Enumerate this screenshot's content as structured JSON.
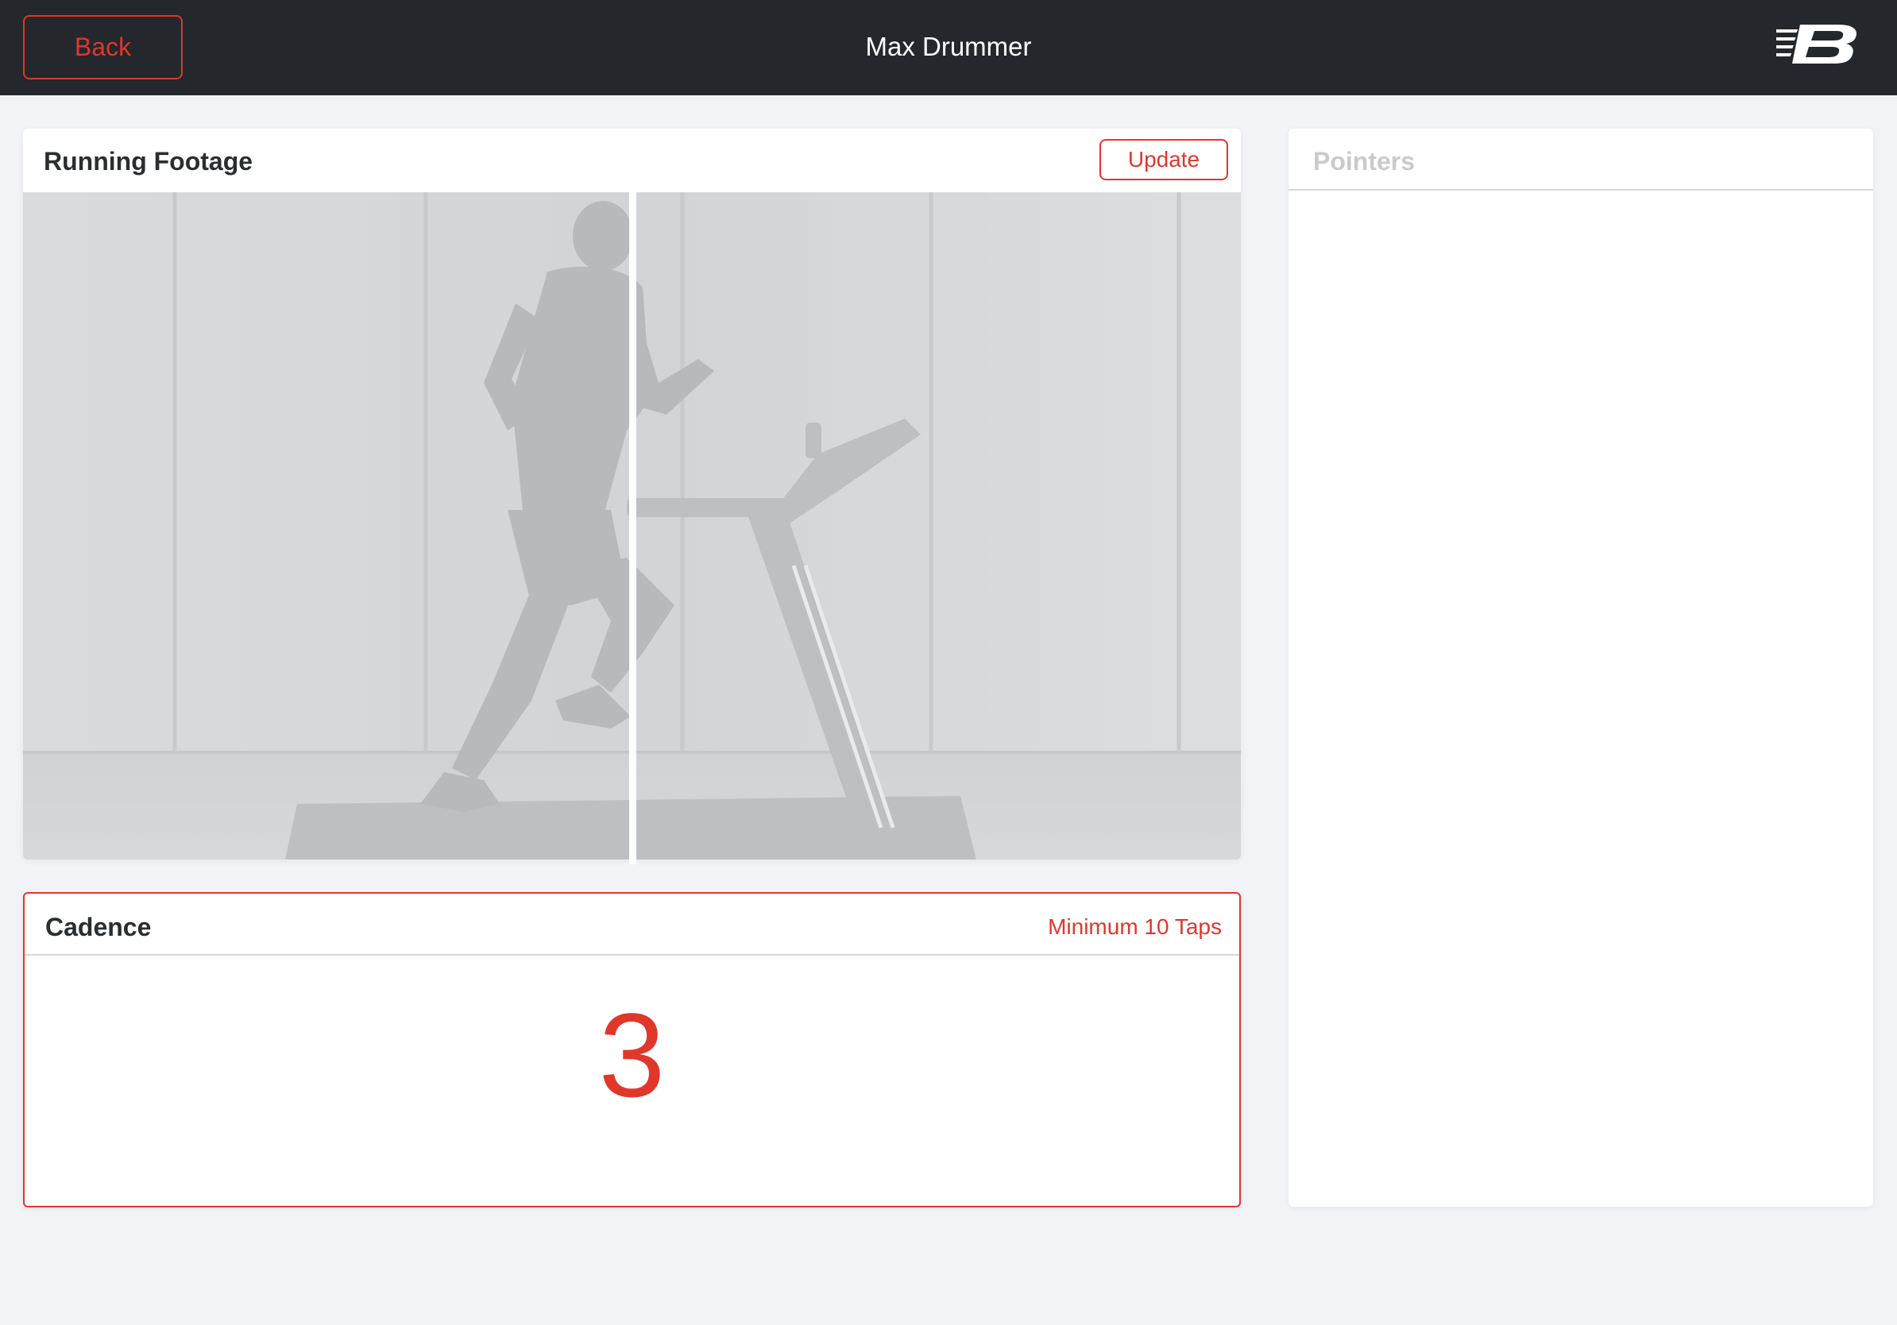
{
  "header": {
    "back_label": "Back",
    "title": "Max Drummer",
    "logo_icon": "new-balance-logo-icon"
  },
  "footage": {
    "title": "Running Footage",
    "update_label": "Update"
  },
  "cadence": {
    "title": "Cadence",
    "hint": "Minimum 10 Taps",
    "tap_count": "3"
  },
  "pointers": {
    "title": "Pointers"
  },
  "colors": {
    "accent": "#e0372b",
    "header_bg": "#24272c",
    "page_bg": "#f2f3f7"
  }
}
